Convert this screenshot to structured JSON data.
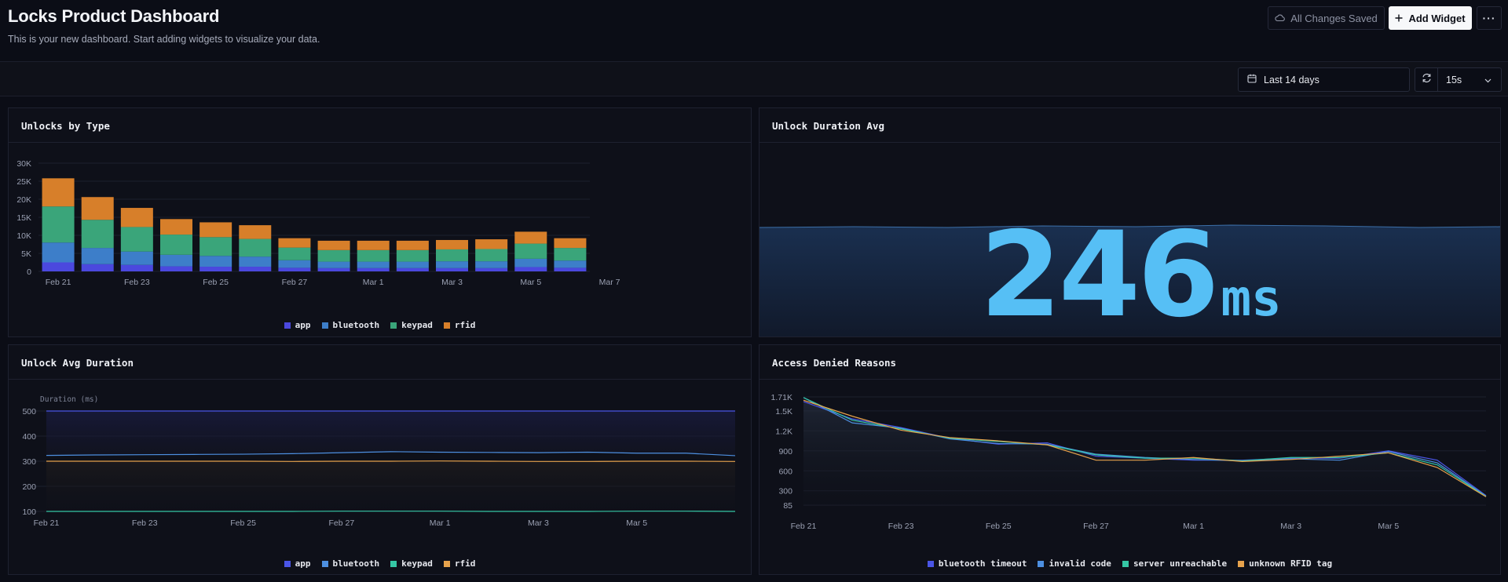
{
  "header": {
    "title": "Locks Product Dashboard",
    "subtitle": "This is your new dashboard. Start adding widgets to visualize your data.",
    "saved_label": "All Changes Saved",
    "add_widget_label": "Add Widget",
    "more_label": "···"
  },
  "toolbar": {
    "date_range": "Last 14 days",
    "interval": "15s"
  },
  "icons": {
    "cloud": "cloud-check-icon",
    "plus": "plus-icon",
    "calendar": "calendar-icon",
    "refresh": "refresh-icon",
    "chevron": "chevron-down-icon"
  },
  "colors": {
    "app": "#4b48de",
    "bluetooth": "#3d7ec9",
    "keypad": "#3aa57a",
    "rfid": "#d77f2a",
    "big_number": "#56bff5",
    "line_app": "#4a55e6",
    "line_bluetooth": "#4d8fe0",
    "line_keypad": "#35c7a5",
    "line_rfid": "#e6a24c"
  },
  "panels": {
    "unlocks": {
      "title": "Unlocks by Type"
    },
    "duration_avg": {
      "title": "Unlock Duration Avg",
      "value": "246",
      "unit": "ms"
    },
    "avg_duration": {
      "title": "Unlock Avg Duration"
    },
    "denied": {
      "title": "Access Denied Reasons"
    }
  },
  "chart_data": [
    {
      "type": "bar",
      "stacked": true,
      "title": "Unlocks by Type",
      "x_tick_labels": [
        "Feb 21",
        "Feb 23",
        "Feb 25",
        "Feb 27",
        "Mar 1",
        "Mar 3",
        "Mar 5",
        "Mar 7"
      ],
      "y_tick_labels": [
        "0",
        "5K",
        "10K",
        "15K",
        "20K",
        "25K",
        "30K"
      ],
      "ylim": [
        0,
        30000
      ],
      "categories": [
        "Feb 21",
        "Feb 22",
        "Feb 23",
        "Feb 24",
        "Feb 25",
        "Feb 26",
        "Feb 27",
        "Feb 28",
        "Mar 1",
        "Mar 2",
        "Mar 3",
        "Mar 4",
        "Mar 5",
        "Mar 6"
      ],
      "series": [
        {
          "name": "app",
          "values": [
            2500,
            2000,
            1800,
            1400,
            1300,
            1300,
            1000,
            900,
            900,
            900,
            900,
            900,
            1200,
            1000
          ]
        },
        {
          "name": "bluetooth",
          "values": [
            5500,
            4500,
            3700,
            3200,
            3000,
            2800,
            2100,
            1800,
            1800,
            1800,
            1900,
            1900,
            2300,
            2000
          ]
        },
        {
          "name": "keypad",
          "values": [
            10000,
            7800,
            6800,
            5600,
            5200,
            4900,
            3500,
            3200,
            3200,
            3200,
            3300,
            3400,
            4200,
            3500
          ]
        },
        {
          "name": "rfid",
          "values": [
            7800,
            6300,
            5300,
            4300,
            4100,
            3800,
            2600,
            2600,
            2600,
            2600,
            2600,
            2700,
            3300,
            2700
          ]
        }
      ],
      "legend": "bottom",
      "grid": true
    },
    {
      "type": "line",
      "title": "Unlock Avg Duration",
      "ylabel": "Duration (ms)",
      "x_tick_labels": [
        "Feb 21",
        "Feb 23",
        "Feb 25",
        "Feb 27",
        "Mar 1",
        "Mar 3",
        "Mar 5"
      ],
      "y_tick_labels": [
        "100",
        "200",
        "300",
        "400",
        "500"
      ],
      "ylim": [
        100,
        500
      ],
      "x": [
        "Feb 21",
        "Feb 22",
        "Feb 23",
        "Feb 24",
        "Feb 25",
        "Feb 26",
        "Feb 27",
        "Feb 28",
        "Mar 1",
        "Mar 2",
        "Mar 3",
        "Mar 4",
        "Mar 5",
        "Mar 6",
        "Mar 7"
      ],
      "series": [
        {
          "name": "app",
          "values": [
            500,
            500,
            500,
            500,
            500,
            500,
            500,
            500,
            500,
            500,
            500,
            500,
            500,
            500,
            500
          ]
        },
        {
          "name": "bluetooth",
          "values": [
            323,
            325,
            326,
            327,
            328,
            330,
            334,
            338,
            336,
            335,
            334,
            336,
            332,
            332,
            322
          ]
        },
        {
          "name": "keypad",
          "values": [
            100,
            100,
            100,
            100,
            100,
            100,
            101,
            101,
            101,
            100,
            100,
            100,
            101,
            101,
            100
          ]
        },
        {
          "name": "rfid",
          "values": [
            300,
            300,
            300,
            300,
            300,
            299,
            300,
            300,
            301,
            300,
            299,
            299,
            300,
            300,
            299
          ]
        }
      ],
      "legend": "bottom",
      "grid": true
    },
    {
      "type": "area",
      "title": "Access Denied Reasons",
      "x_tick_labels": [
        "Feb 21",
        "Feb 23",
        "Feb 25",
        "Feb 27",
        "Mar 1",
        "Mar 3",
        "Mar 5"
      ],
      "y_tick_labels": [
        "85",
        "300",
        "600",
        "900",
        "1.2K",
        "1.5K",
        "1.71K"
      ],
      "ylim": [
        85,
        1710
      ],
      "x": [
        "Feb 21",
        "Feb 22",
        "Feb 23",
        "Feb 24",
        "Feb 25",
        "Feb 26",
        "Feb 27",
        "Feb 28",
        "Mar 1",
        "Mar 2",
        "Mar 3",
        "Mar 4",
        "Mar 5",
        "Mar 6",
        "Mar 7"
      ],
      "series": [
        {
          "name": "bluetooth timeout",
          "values": [
            1640,
            1380,
            1250,
            1090,
            1000,
            1020,
            820,
            790,
            760,
            760,
            790,
            790,
            900,
            760,
            230
          ]
        },
        {
          "name": "invalid code",
          "values": [
            1700,
            1320,
            1240,
            1080,
            1010,
            1000,
            850,
            800,
            770,
            750,
            780,
            760,
            890,
            720,
            220
          ]
        },
        {
          "name": "server unreachable",
          "values": [
            1700,
            1360,
            1230,
            1090,
            1040,
            990,
            840,
            790,
            790,
            750,
            800,
            800,
            870,
            690,
            215
          ]
        },
        {
          "name": "unknown RFID tag",
          "values": [
            1660,
            1420,
            1210,
            1100,
            1050,
            990,
            760,
            760,
            800,
            740,
            770,
            820,
            870,
            650,
            210
          ]
        }
      ],
      "legend": "bottom",
      "grid": true
    }
  ]
}
